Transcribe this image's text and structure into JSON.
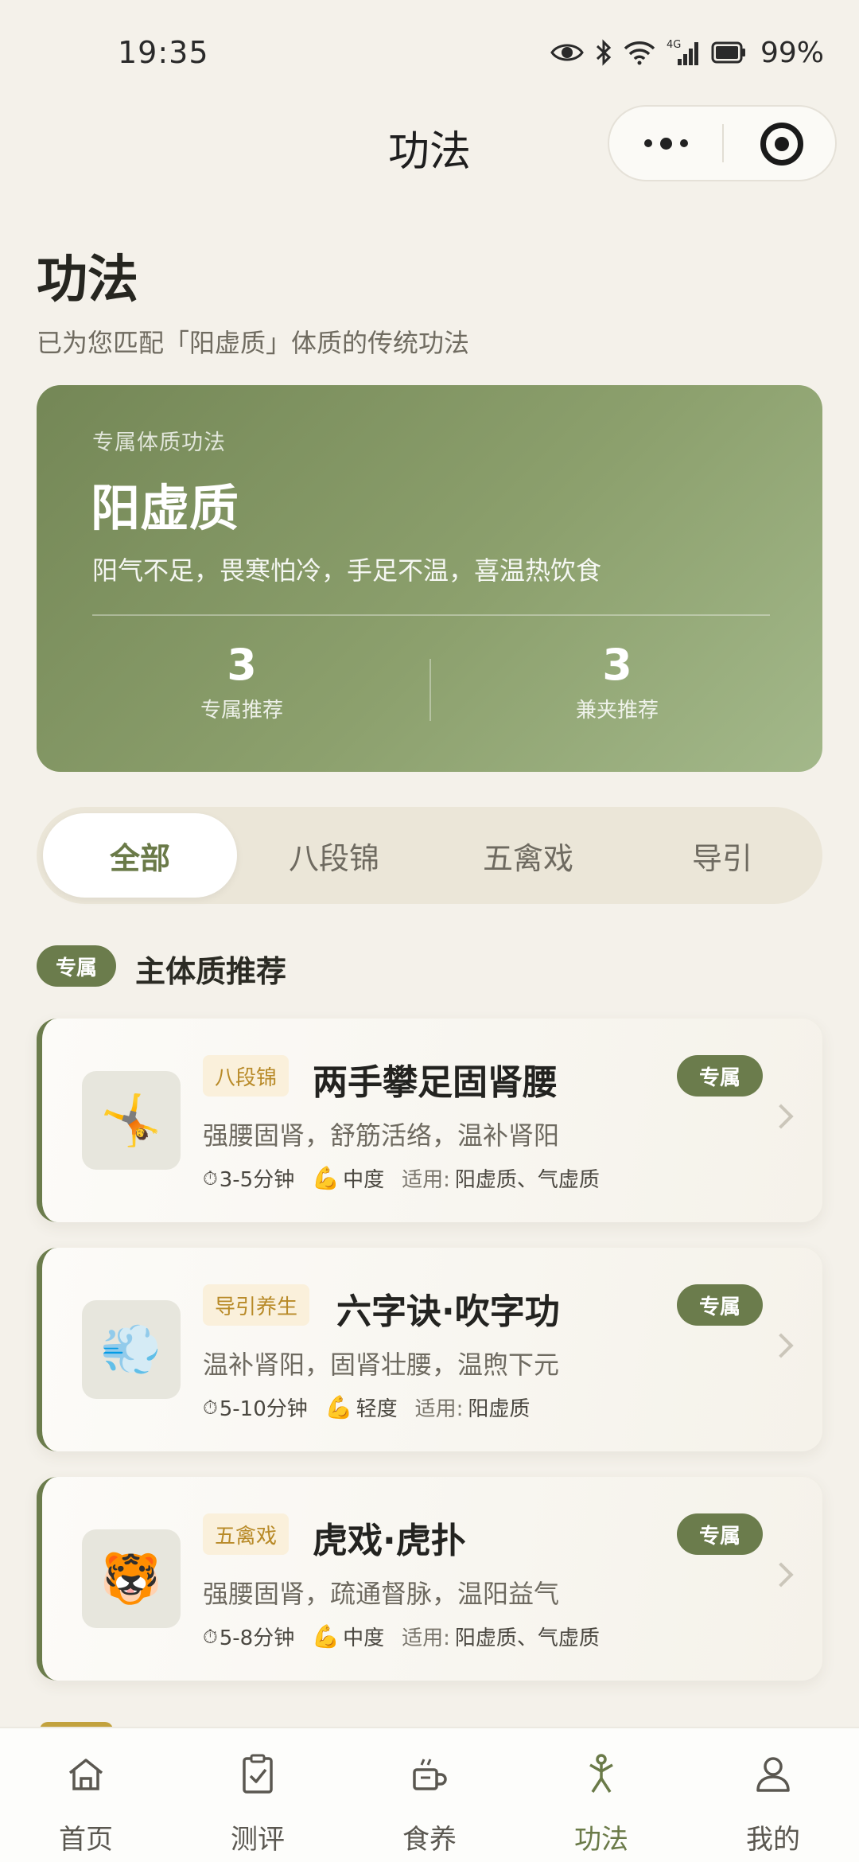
{
  "status_bar": {
    "time": "19:35",
    "network": "4G",
    "battery": "99%",
    "icons": [
      "eye-icon",
      "bluetooth-icon",
      "wifi-icon",
      "signal-icon",
      "battery-icon"
    ]
  },
  "nav": {
    "title": "功法",
    "capsule_icons": [
      "more-dots-icon",
      "target-icon"
    ]
  },
  "header": {
    "title": "功法",
    "subtitle": "已为您匹配「阳虚质」体质的传统功法"
  },
  "hero": {
    "kicker": "专属体质功法",
    "title": "阳虚质",
    "description": "阳气不足，畏寒怕冷，手足不温，喜温热饮食",
    "stats": [
      {
        "value": "3",
        "label": "专属推荐"
      },
      {
        "value": "3",
        "label": "兼夹推荐"
      }
    ],
    "colors": {
      "start": "#748756",
      "end": "#a3b88a"
    }
  },
  "tabs": [
    {
      "label": "全部",
      "active": true
    },
    {
      "label": "八段锦",
      "active": false
    },
    {
      "label": "五禽戏",
      "active": false
    },
    {
      "label": "导引",
      "active": false
    }
  ],
  "section": {
    "badge": "专属",
    "title": "主体质推荐"
  },
  "cards": [
    {
      "thumb_icon": "🤸",
      "category": "八段锦",
      "title": "两手攀足固肾腰",
      "badge": "专属",
      "description": "强腰固肾，舒筋活络，温补肾阳",
      "clock_icon": "⏱",
      "duration": "3-5分钟",
      "intensity_icon": "💪",
      "intensity": "中度",
      "applies_label": "适用:",
      "applies": "阳虚质、气虚质"
    },
    {
      "thumb_icon": "💨",
      "category": "导引养生",
      "title": "六字诀·吹字功",
      "badge": "专属",
      "description": "温补肾阳，固肾壮腰，温煦下元",
      "clock_icon": "⏱",
      "duration": "5-10分钟",
      "intensity_icon": "💪",
      "intensity": "轻度",
      "applies_label": "适用:",
      "applies": "阳虚质"
    },
    {
      "thumb_icon": "🐯",
      "category": "五禽戏",
      "title": "虎戏·虎扑",
      "badge": "专属",
      "description": "强腰固肾，疏通督脉，温阳益气",
      "clock_icon": "⏱",
      "duration": "5-8分钟",
      "intensity_icon": "💪",
      "intensity": "中度",
      "applies_label": "适用:",
      "applies": "阳虚质、气虚质"
    }
  ],
  "bottom_nav": [
    {
      "label": "首页",
      "icon": "home-icon",
      "active": false
    },
    {
      "label": "测评",
      "icon": "clipboard-icon",
      "active": false
    },
    {
      "label": "食养",
      "icon": "bowl-icon",
      "active": false
    },
    {
      "label": "功法",
      "icon": "exercise-figure-icon",
      "active": true
    },
    {
      "label": "我的",
      "icon": "user-icon",
      "active": false
    }
  ],
  "colors": {
    "accent": "#6b7c4c",
    "background": "#f4f1ea",
    "category_tag_bg": "#faf0db",
    "category_tag_text": "#b88a28"
  }
}
